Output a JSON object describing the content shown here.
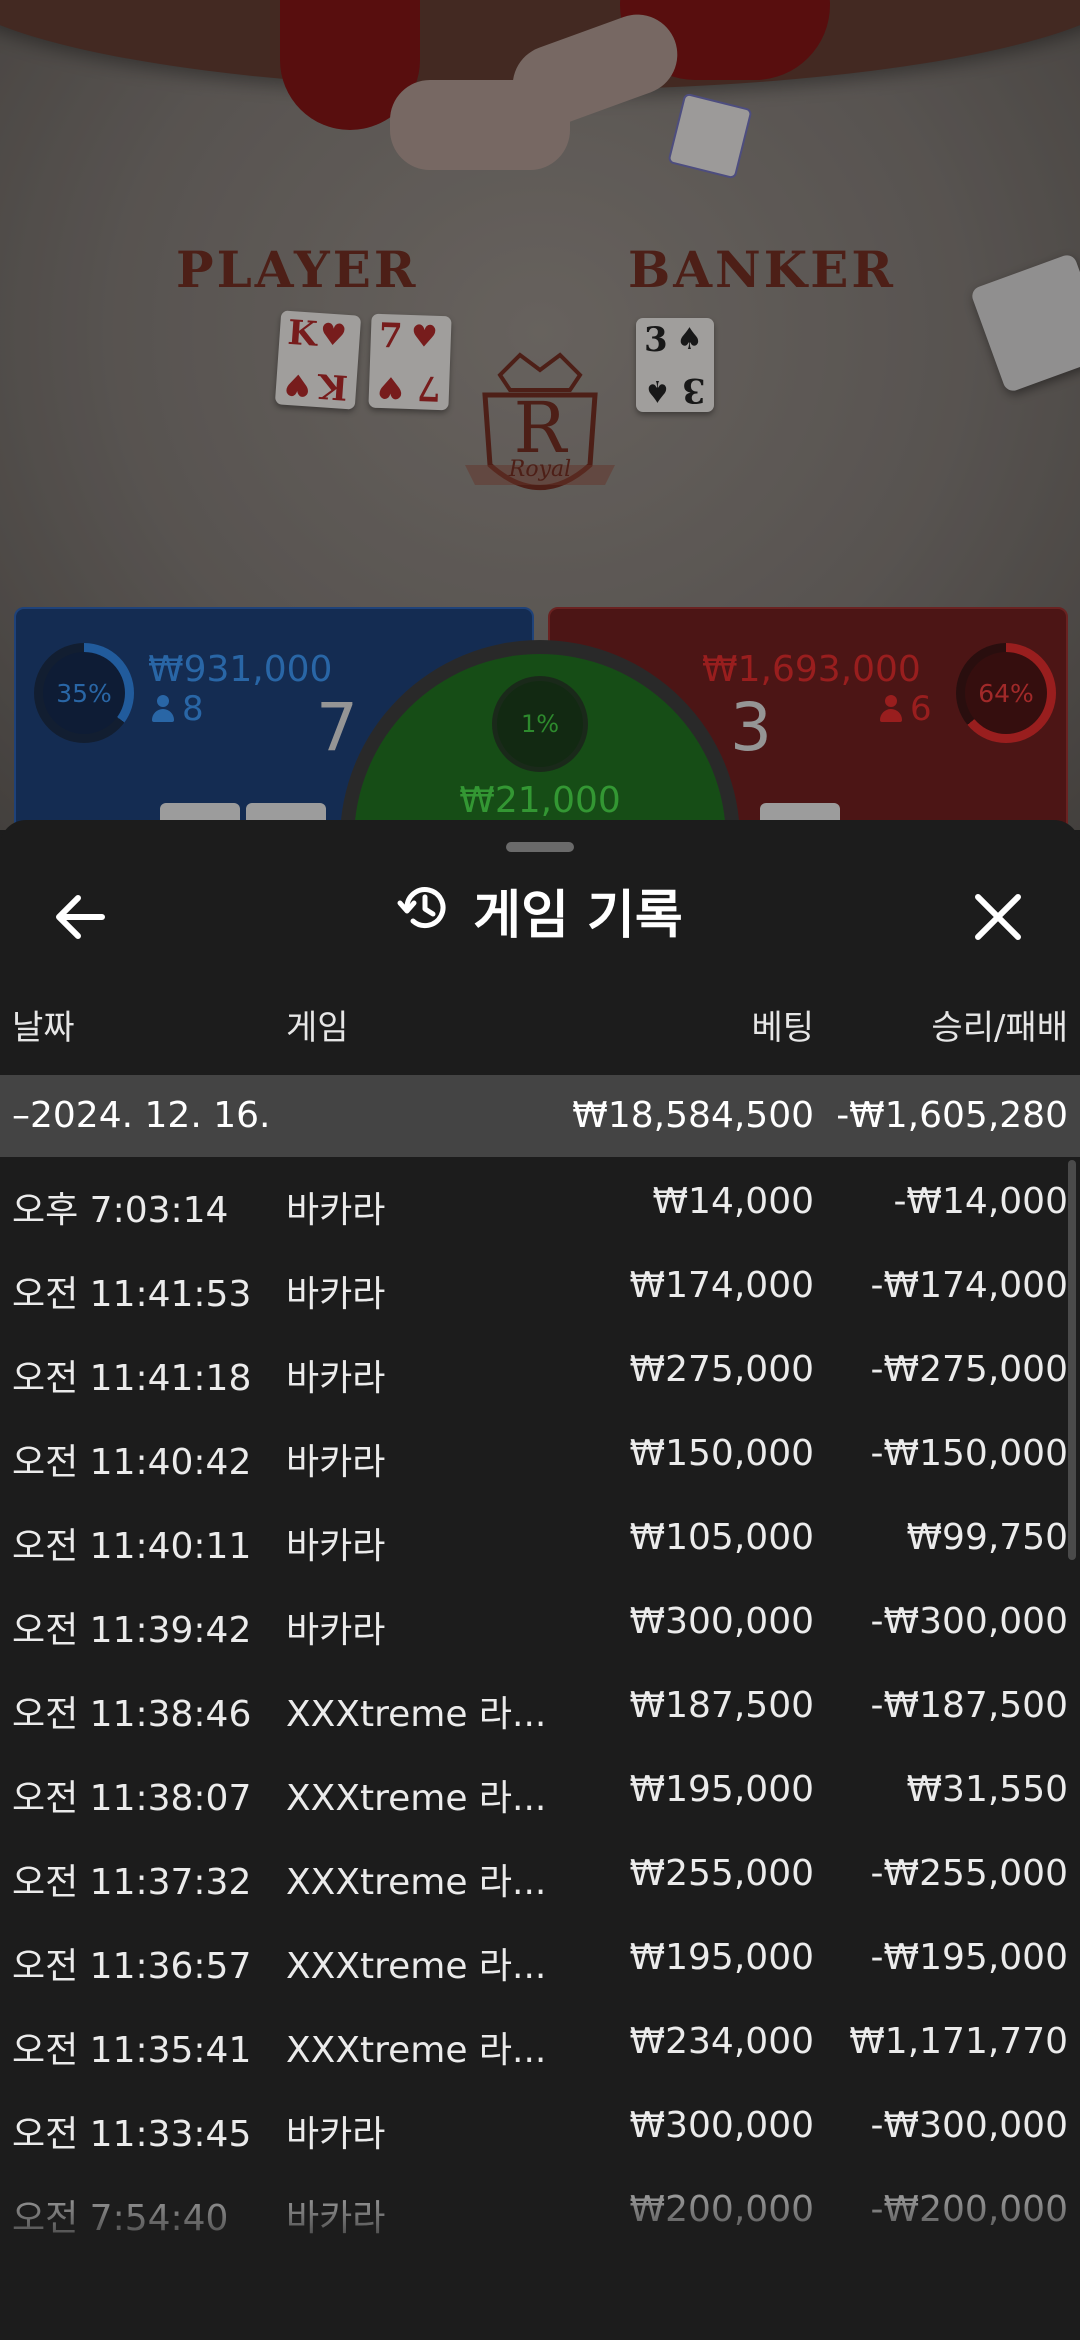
{
  "table": {
    "player_label": "PLAYER",
    "banker_label": "BANKER",
    "crest_letter": "R",
    "crest_ribbon": "Royal",
    "player_cards": [
      {
        "rank": "K",
        "suit": "♥"
      },
      {
        "rank": "7",
        "suit": "♥"
      }
    ],
    "banker_cards": [
      {
        "rank": "3",
        "suit": "♠"
      }
    ]
  },
  "bets": {
    "player": {
      "percent": "35%",
      "percent_value": 35,
      "amount": "₩931,000",
      "count": "8",
      "score": "7",
      "color": "#2f7fd8"
    },
    "banker": {
      "percent": "64%",
      "percent_value": 64,
      "amount": "₩1,693,000",
      "count": "6",
      "score": "3",
      "color": "#d42a2a"
    },
    "tie": {
      "percent": "1%",
      "amount": "₩21,000",
      "color": "#2fb82f"
    }
  },
  "history": {
    "title": "게임 기록",
    "columns": {
      "date": "날짜",
      "game": "게임",
      "bet": "베팅",
      "win_loss": "승리/패배"
    },
    "group": {
      "date": "–2024. 12. 16.",
      "bet": "₩18,584,500",
      "win_loss": "-₩1,605,280"
    },
    "rows": [
      {
        "time": "오후 7:03:14",
        "game": "바카라",
        "bet": "₩14,000",
        "win_loss": "-₩14,000"
      },
      {
        "time": "오전 11:41:53",
        "game": "바카라",
        "bet": "₩174,000",
        "win_loss": "-₩174,000"
      },
      {
        "time": "오전 11:41:18",
        "game": "바카라",
        "bet": "₩275,000",
        "win_loss": "-₩275,000"
      },
      {
        "time": "오전 11:40:42",
        "game": "바카라",
        "bet": "₩150,000",
        "win_loss": "-₩150,000"
      },
      {
        "time": "오전 11:40:11",
        "game": "바카라",
        "bet": "₩105,000",
        "win_loss": "₩99,750"
      },
      {
        "time": "오전 11:39:42",
        "game": "바카라",
        "bet": "₩300,000",
        "win_loss": "-₩300,000"
      },
      {
        "time": "오전 11:38:46",
        "game": "XXXtreme 라...",
        "bet": "₩187,500",
        "win_loss": "-₩187,500"
      },
      {
        "time": "오전 11:38:07",
        "game": "XXXtreme 라...",
        "bet": "₩195,000",
        "win_loss": "₩31,550"
      },
      {
        "time": "오전 11:37:32",
        "game": "XXXtreme 라...",
        "bet": "₩255,000",
        "win_loss": "-₩255,000"
      },
      {
        "time": "오전 11:36:57",
        "game": "XXXtreme 라...",
        "bet": "₩195,000",
        "win_loss": "-₩195,000"
      },
      {
        "time": "오전 11:35:41",
        "game": "XXXtreme 라...",
        "bet": "₩234,000",
        "win_loss": "₩1,171,770"
      },
      {
        "time": "오전 11:33:45",
        "game": "바카라",
        "bet": "₩300,000",
        "win_loss": "-₩300,000"
      },
      {
        "time": "오전 7:54:40",
        "game": "바카라",
        "bet": "₩200,000",
        "win_loss": "-₩200,000"
      }
    ]
  },
  "icons": {
    "back": "arrow-left-icon",
    "history": "history-clock-icon",
    "close": "close-icon"
  }
}
